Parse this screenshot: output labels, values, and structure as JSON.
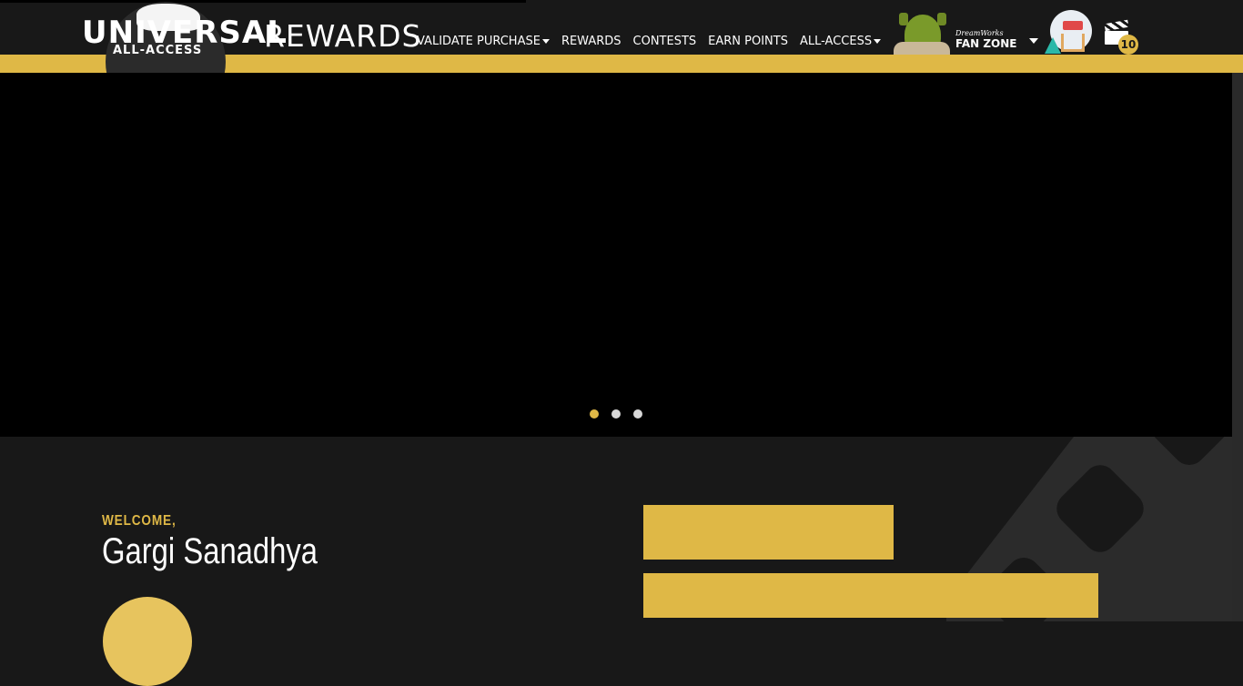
{
  "header": {
    "logo_main": "UNIVERSAL",
    "logo_sub": "ALL-ACCESS",
    "title": "REWARDS",
    "nav": [
      {
        "label": "VALIDATE PURCHASE",
        "dropdown": true
      },
      {
        "label": "REWARDS",
        "dropdown": false
      },
      {
        "label": "CONTESTS",
        "dropdown": false
      },
      {
        "label": "EARN POINTS",
        "dropdown": false
      },
      {
        "label": "ALL-ACCESS",
        "dropdown": true
      }
    ],
    "fanzone": {
      "brand": "DreamWorks",
      "label": "FAN ZONE"
    },
    "points_badge": "10"
  },
  "hero": {
    "slides": 3,
    "active_slide": 0
  },
  "welcome": {
    "greeting": "WELCOME,",
    "name": "Gargi Sanadhya"
  },
  "colors": {
    "accent": "#dfb846",
    "background": "#181818",
    "hero": "#000000"
  }
}
